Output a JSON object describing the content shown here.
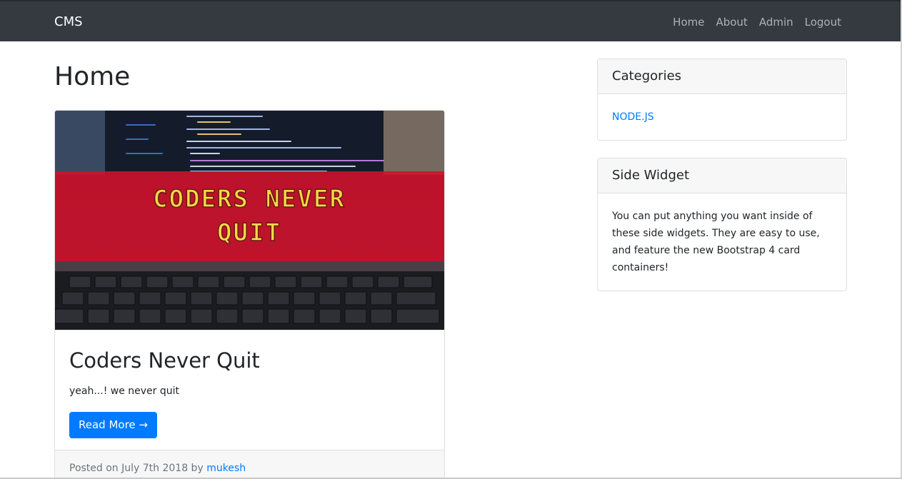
{
  "navbar": {
    "brand": "CMS",
    "links": [
      {
        "label": "Home"
      },
      {
        "label": "About"
      },
      {
        "label": "Admin"
      },
      {
        "label": "Logout"
      }
    ]
  },
  "page": {
    "title": "Home"
  },
  "post": {
    "image_banner_line1": "CODERS NEVER",
    "image_banner_line2": "QUIT",
    "title": "Coders Never Quit",
    "excerpt": "yeah...! we never quit",
    "read_more_label": "Read More →",
    "footer_prefix": "Posted on July 7th 2018 by",
    "author": "mukesh"
  },
  "sidebar": {
    "categories": {
      "title": "Categories",
      "items": [
        {
          "label": "NODE.JS"
        }
      ]
    },
    "widget": {
      "title": "Side Widget",
      "text": "You can put anything you want inside of these side widgets. They are easy to use, and feature the new Bootstrap 4 card containers!"
    }
  },
  "colors": {
    "navbar_bg": "#343a40",
    "link": "#007bff",
    "banner_red": "#d4102a",
    "banner_text": "#f7d84a"
  }
}
